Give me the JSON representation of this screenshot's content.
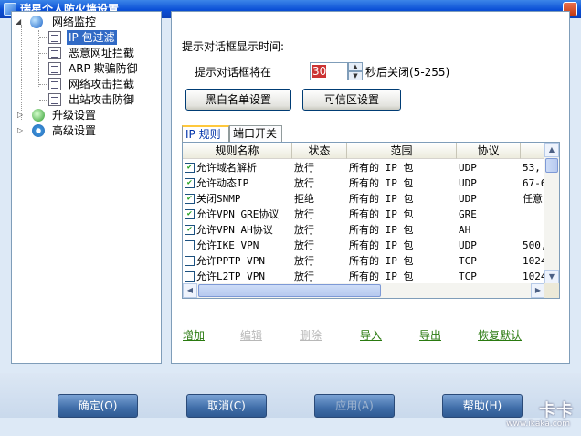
{
  "window": {
    "title": "瑞星个人防火墙设置"
  },
  "tree": {
    "items": [
      {
        "label": "网络监控",
        "icon": "globe-icon"
      },
      {
        "label": "IP 包过滤",
        "icon": "page-icon",
        "selected": true
      },
      {
        "label": "恶意网址拦截",
        "icon": "page-icon"
      },
      {
        "label": "ARP 欺骗防御",
        "icon": "page-icon"
      },
      {
        "label": "网络攻击拦截",
        "icon": "page-icon"
      },
      {
        "label": "出站攻击防御",
        "icon": "page-icon"
      },
      {
        "label": "升级设置",
        "icon": "shield-icon"
      },
      {
        "label": "高级设置",
        "icon": "gear-icon"
      }
    ]
  },
  "panel": {
    "prompt_header": "提示对话框显示时间:",
    "prompt_label": "提示对话框将在",
    "prompt_value": "30",
    "prompt_suffix": "秒后关闭(5-255)",
    "blacklist_button": "黑白名单设置",
    "trusted_button": "可信区设置"
  },
  "tabs": [
    {
      "label": "IP 规则",
      "active": true
    },
    {
      "label": "端口开关",
      "active": false
    }
  ],
  "grid": {
    "columns": [
      "规则名称",
      "状态",
      "范围",
      "协议",
      ""
    ],
    "rows": [
      {
        "checked": true,
        "name": "允许域名解析",
        "status": "放行",
        "scope": "所有的 IP 包",
        "protocol": "UDP",
        "port": "53,"
      },
      {
        "checked": true,
        "name": "允许动态IP",
        "status": "放行",
        "scope": "所有的 IP 包",
        "protocol": "UDP",
        "port": "67-6"
      },
      {
        "checked": true,
        "name": "关闭SNMP",
        "status": "拒绝",
        "scope": "所有的 IP 包",
        "protocol": "UDP",
        "port": "任意"
      },
      {
        "checked": true,
        "name": "允许VPN GRE协议",
        "status": "放行",
        "scope": "所有的 IP 包",
        "protocol": "GRE",
        "port": ""
      },
      {
        "checked": true,
        "name": "允许VPN AH协议",
        "status": "放行",
        "scope": "所有的 IP 包",
        "protocol": "AH",
        "port": ""
      },
      {
        "checked": false,
        "name": "允许IKE VPN",
        "status": "放行",
        "scope": "所有的 IP 包",
        "protocol": "UDP",
        "port": "500,"
      },
      {
        "checked": false,
        "name": "允许PPTP VPN",
        "status": "放行",
        "scope": "所有的 IP 包",
        "protocol": "TCP",
        "port": "1024"
      },
      {
        "checked": false,
        "name": "允许L2TP VPN",
        "status": "放行",
        "scope": "所有的 IP 包",
        "protocol": "TCP",
        "port": "1024"
      }
    ]
  },
  "actions": {
    "add": "增加",
    "edit": "编辑",
    "delete": "删除",
    "import": "导入",
    "export": "导出",
    "restore": "恢复默认"
  },
  "footer": {
    "ok": "确定(O)",
    "cancel": "取消(C)",
    "apply": "应用(A)",
    "help": "帮助(H)"
  },
  "watermark": {
    "brand": "卡卡",
    "url": "www.ikaka.com"
  },
  "colors": {
    "link_enabled": "#2a7a10",
    "link_disabled": "#b8b8b8",
    "titlebar": "#0a4fd6"
  }
}
